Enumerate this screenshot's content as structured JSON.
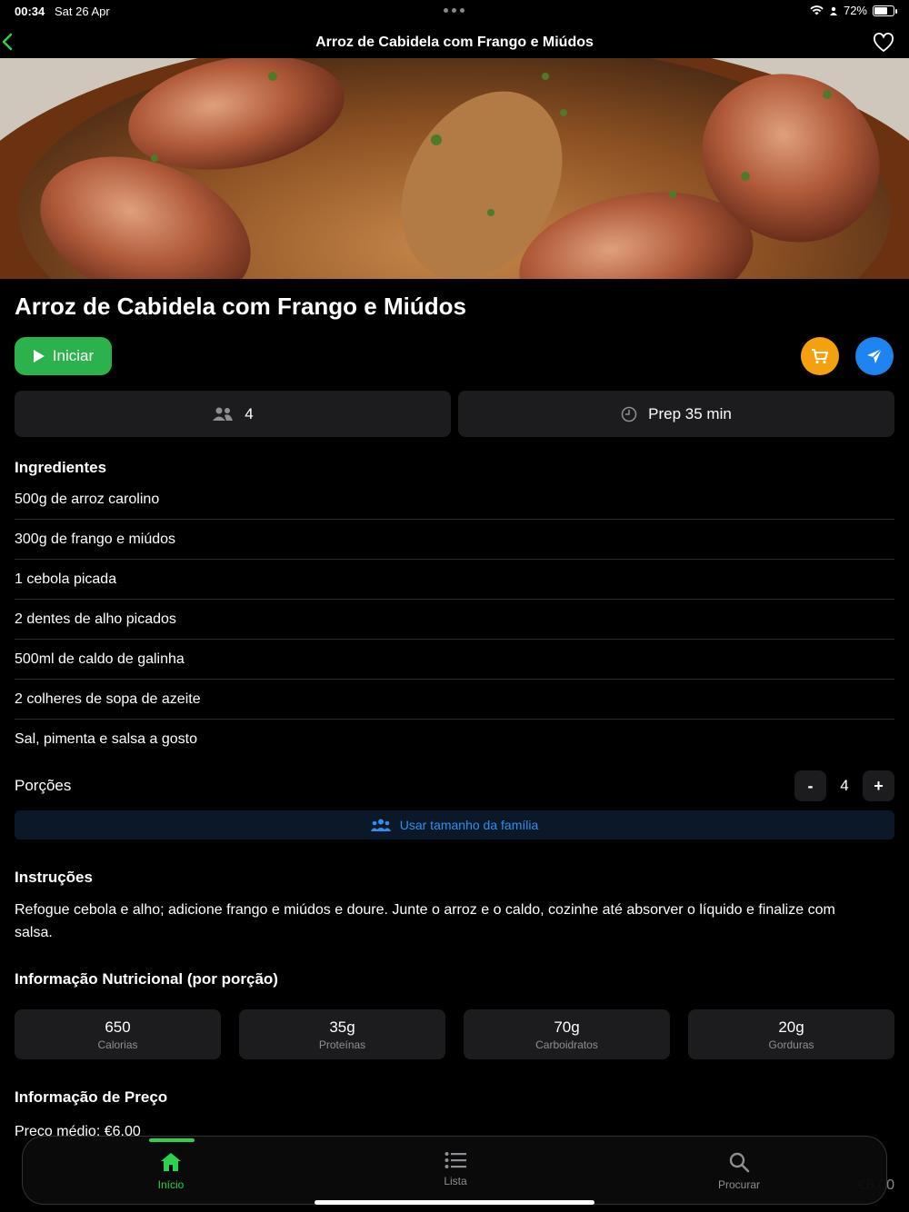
{
  "status_bar": {
    "time": "00:34",
    "date": "Sat 26 Apr",
    "battery": "72%",
    "battery_level": 0.72
  },
  "nav": {
    "title": "Arroz de Cabidela com Frango e Miúdos",
    "back_icon": "chevron-left-icon",
    "favorite_icon": "heart-icon"
  },
  "recipe": {
    "title": "Arroz de Cabidela com Frango e Miúdos",
    "start_label": "Iniciar",
    "servings": "4",
    "prep": "Prep 35 min"
  },
  "ingredients": {
    "title": "Ingredientes",
    "items": [
      "500g de arroz carolino",
      "300g de frango e miúdos",
      "1 cebola picada",
      "2 dentes de alho picados",
      "500ml de caldo de galinha",
      "2 colheres de sopa de azeite",
      "Sal, pimenta e salsa a gosto"
    ]
  },
  "portions": {
    "label": "Porções",
    "minus": "-",
    "value": "4",
    "plus": "+",
    "family_button": "Usar tamanho da família"
  },
  "instructions": {
    "title": "Instruções",
    "text": "Refogue cebola e alho; adicione frango e miúdos e doure. Junte o arroz e o caldo, cozinhe até absorver o líquido e finalize com salsa."
  },
  "nutrition": {
    "title": "Informação Nutricional (por porção)",
    "items": [
      {
        "value": "650",
        "label": "Calorias"
      },
      {
        "value": "35g",
        "label": "Proteínas"
      },
      {
        "value": "70g",
        "label": "Carboidratos"
      },
      {
        "value": "20g",
        "label": "Gorduras"
      }
    ]
  },
  "price": {
    "title": "Informação de Preço",
    "average": "Preço médio: €6.00",
    "right_value": "€6.00"
  },
  "tabs": [
    {
      "label": "Início",
      "icon": "home-icon",
      "active": true
    },
    {
      "label": "Lista",
      "icon": "list-icon",
      "active": false
    },
    {
      "label": "Procurar",
      "icon": "search-icon",
      "active": false
    }
  ],
  "colors": {
    "accent_green": "#2bb24c",
    "cart_orange": "#f5a10f",
    "share_blue": "#1e84f0",
    "link_blue": "#2f8ef0"
  }
}
